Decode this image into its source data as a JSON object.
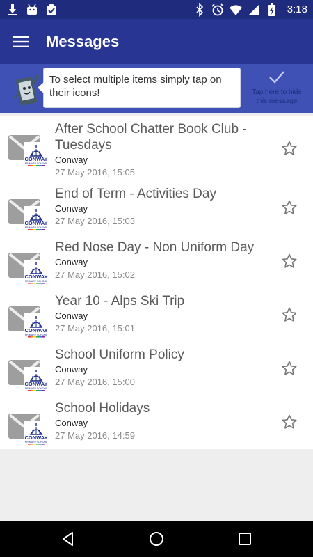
{
  "status_bar": {
    "time": "3:18",
    "left_icons": [
      "download-icon",
      "android-debug-icon",
      "clipboard-check-icon"
    ],
    "right_icons": [
      "bluetooth-icon",
      "alarm-icon",
      "wifi-icon",
      "signal-icon",
      "battery-charging-icon"
    ]
  },
  "app_bar": {
    "title": "Messages",
    "menu_icon": "hamburger-menu-icon"
  },
  "tip_banner": {
    "message": "To select multiple items simply tap on their icons!",
    "hide_line1": "Tap here to hide",
    "hide_line2": "this message",
    "mascot_icon": "phone-mascot-icon",
    "check_icon": "checkmark-icon"
  },
  "messages": [
    {
      "title": "After School Chatter Book Club - Tuesdays",
      "sender": "Conway",
      "date": "27 May 2016, 15:05"
    },
    {
      "title": "End of Term - Activities Day",
      "sender": "Conway",
      "date": "27 May 2016, 15:03"
    },
    {
      "title": "Red Nose Day - Non Uniform Day",
      "sender": "Conway",
      "date": "27 May 2016, 15:02"
    },
    {
      "title": "Year 10 - Alps Ski Trip",
      "sender": "Conway",
      "date": "27 May 2016, 15:01"
    },
    {
      "title": "School Uniform Policy",
      "sender": "Conway",
      "date": "27 May 2016, 15:00"
    },
    {
      "title": "School Holidays",
      "sender": "Conway",
      "date": "27 May 2016, 14:59"
    }
  ],
  "school_logo": {
    "name": "CONWAY",
    "subtitle": "PRIMARY SCHOOL"
  },
  "colors": {
    "status_bar": "#1f2c7e",
    "app_bar": "#283593",
    "banner": "#3f51b5",
    "logo_blue": "#1a2a8c"
  },
  "nav_bar": {
    "icons": [
      "back-triangle-icon",
      "home-circle-icon",
      "recents-square-icon"
    ]
  }
}
